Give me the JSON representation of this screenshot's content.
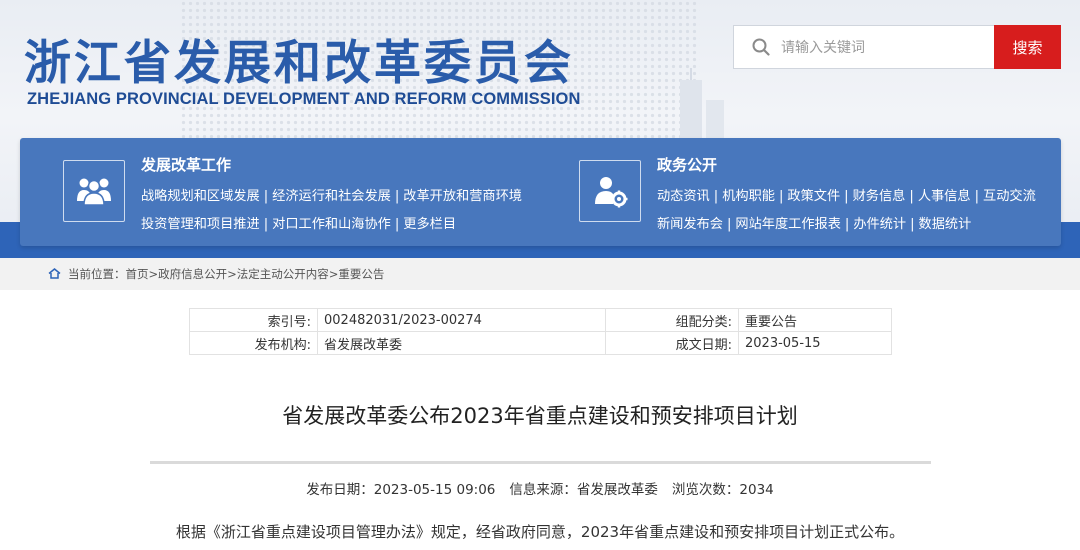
{
  "header": {
    "title_cn": "浙江省发展和改革委员会",
    "title_en": "ZHEJIANG PROVINCIAL DEVELOPMENT AND REFORM COMMISSION",
    "search": {
      "placeholder": "请输入关键词",
      "button_label": "搜索"
    }
  },
  "nav": {
    "groups": [
      {
        "icon": "people-group-icon",
        "title": "发展改革工作",
        "links": [
          "战略规划和区域发展",
          "经济运行和社会发展",
          "改革开放和营商环境",
          "投资管理和项目推进",
          "对口工作和山海协作",
          "更多栏目"
        ]
      },
      {
        "icon": "person-gear-icon",
        "title": "政务公开",
        "links": [
          "动态资讯",
          "机构职能",
          "政策文件",
          "财务信息",
          "人事信息",
          "互动交流",
          "新闻发布会",
          "网站年度工作报表",
          "办件统计",
          "数据统计"
        ]
      }
    ]
  },
  "breadcrumb": {
    "label": "当前位置：",
    "items": [
      "首页",
      "政府信息公开",
      "法定主动公开内容",
      "重要公告"
    ],
    "separator": ">"
  },
  "meta": {
    "rows": [
      {
        "k1": "索引号:",
        "v1": "002482031/2023-00274",
        "k2": "组配分类:",
        "v2": "重要公告"
      },
      {
        "k1": "发布机构:",
        "v1": "省发展改革委",
        "k2": "成文日期:",
        "v2": "2023-05-15"
      }
    ]
  },
  "article": {
    "title": "省发展改革委公布2023年省重点建设和预安排项目计划",
    "pub_date": "发布日期：2023-05-15 09:06",
    "source": "信息来源：省发展改革委",
    "views": "浏览次数：2034",
    "first_line": "根据《浙江省重点建设项目管理办法》规定，经省政府同意，2023年省重点建设和预安排项目计划正式公布。"
  },
  "colors": {
    "brand_blue": "#2a5caa",
    "nav_blue": "#4877bd",
    "band_blue": "#2e64b8",
    "search_red": "#d71d1d"
  }
}
